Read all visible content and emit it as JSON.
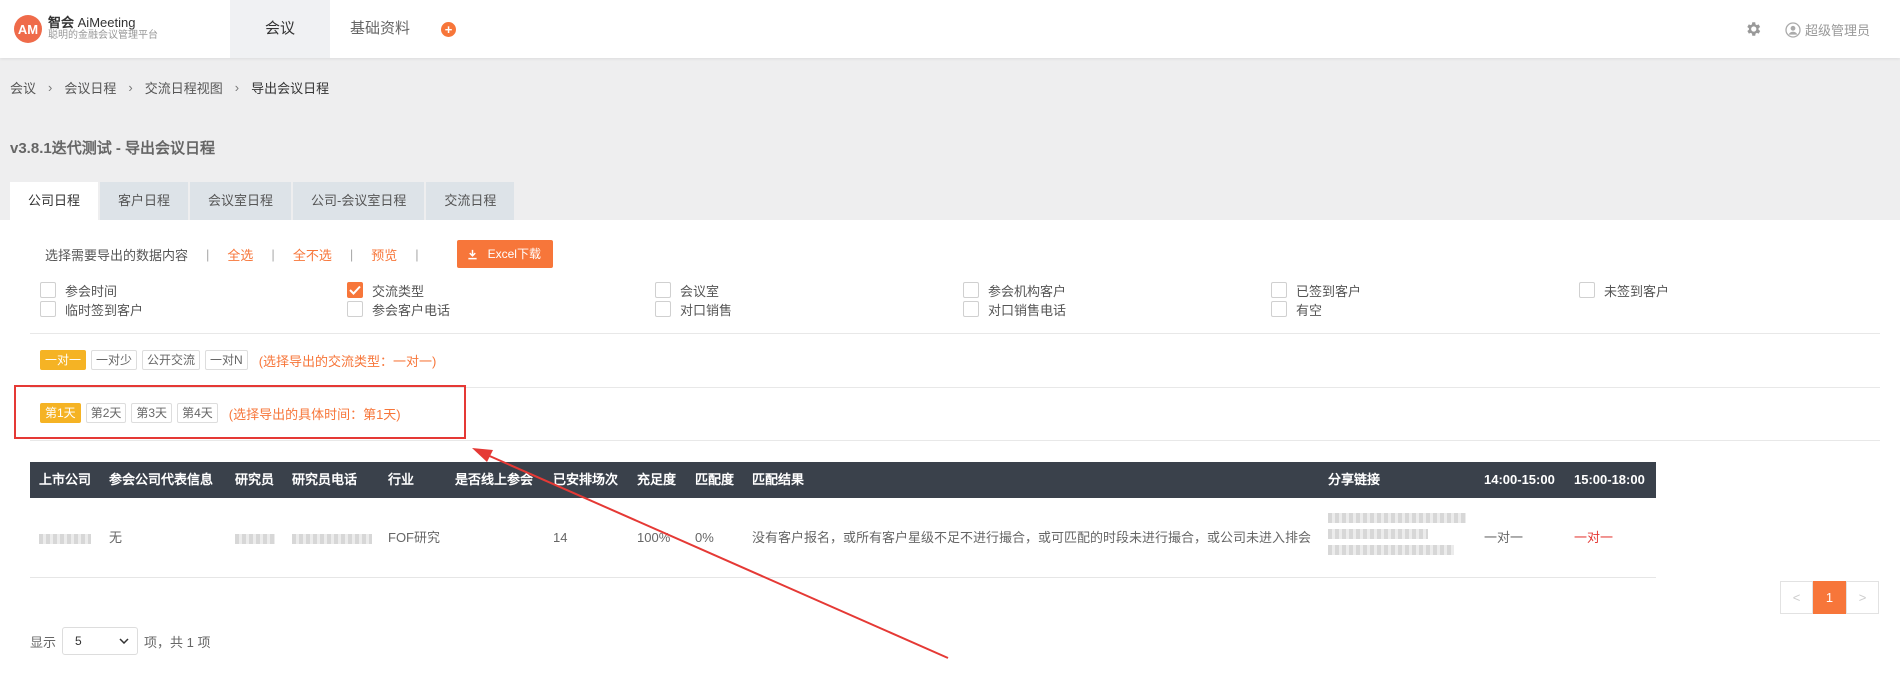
{
  "header": {
    "logo_mark": "AM",
    "logo_name": "智会",
    "logo_name_en": "AiMeeting",
    "logo_sub": "聪明的金融会议管理平台",
    "nav_tabs": [
      {
        "label": "会议"
      },
      {
        "label": "基础资料"
      }
    ],
    "add_symbol": "+",
    "user_name": "超级管理员"
  },
  "breadcrumb": [
    "会议",
    "会议日程",
    "交流日程视图",
    "导出会议日程"
  ],
  "page_title": "v3.8.1迭代测试 - 导出会议日程",
  "tabs": [
    {
      "label": "公司日程",
      "active": true
    },
    {
      "label": "客户日程"
    },
    {
      "label": "会议室日程"
    },
    {
      "label": "公司-会议室日程"
    },
    {
      "label": "交流日程"
    }
  ],
  "options": {
    "select_label": "选择需要导出的数据内容",
    "select_all": "全选",
    "select_none": "全不选",
    "preview": "预览",
    "excel": "Excel下载",
    "sep": "|"
  },
  "checkboxes": [
    {
      "label": "参会时间",
      "checked": false
    },
    {
      "label": "交流类型",
      "checked": true
    },
    {
      "label": "会议室",
      "checked": false
    },
    {
      "label": "参会机构客户",
      "checked": false
    },
    {
      "label": "已签到客户",
      "checked": false
    },
    {
      "label": "未签到客户",
      "checked": false
    },
    {
      "label": "临时签到客户",
      "checked": false
    },
    {
      "label": "参会客户电话",
      "checked": false
    },
    {
      "label": "对口销售",
      "checked": false
    },
    {
      "label": "对口销售电话",
      "checked": false
    },
    {
      "label": "有空",
      "checked": false
    }
  ],
  "exchange_types": {
    "items": [
      "一对一",
      "一对少",
      "公开交流",
      "一对N"
    ],
    "active": 0,
    "hint": "(选择导出的交流类型：一对一)"
  },
  "days": {
    "items": [
      "第1天",
      "第2天",
      "第3天",
      "第4天"
    ],
    "active": 0,
    "hint": "(选择导出的具体时间：第1天)"
  },
  "table": {
    "headers": [
      "上市公司",
      "参会公司代表信息",
      "研究员",
      "研究员电话",
      "行业",
      "是否线上参会",
      "已安排场次",
      "充足度",
      "匹配度",
      "匹配结果",
      "分享链接",
      "14:00-15:00",
      "15:00-18:00"
    ],
    "row": {
      "rep_info": "无",
      "industry": "FOF研究",
      "scheduled": "14",
      "sufficiency": "100%",
      "match": "0%",
      "result": "没有客户报名，或所有客户星级不足不进行撮合，或可匹配的时段未进行撮合，或公司未进入排会",
      "slot1": "一对一",
      "slot2": "一对一"
    }
  },
  "pagination": {
    "prev": "<",
    "current": "1",
    "next": ">"
  },
  "page_size": {
    "prefix": "显示",
    "value": "5",
    "suffix": "项，共 1 项"
  },
  "colors": {
    "accent": "#f7763a",
    "active_pill": "#f5b324",
    "table_header": "#3a414b",
    "annotation": "#e53935"
  }
}
